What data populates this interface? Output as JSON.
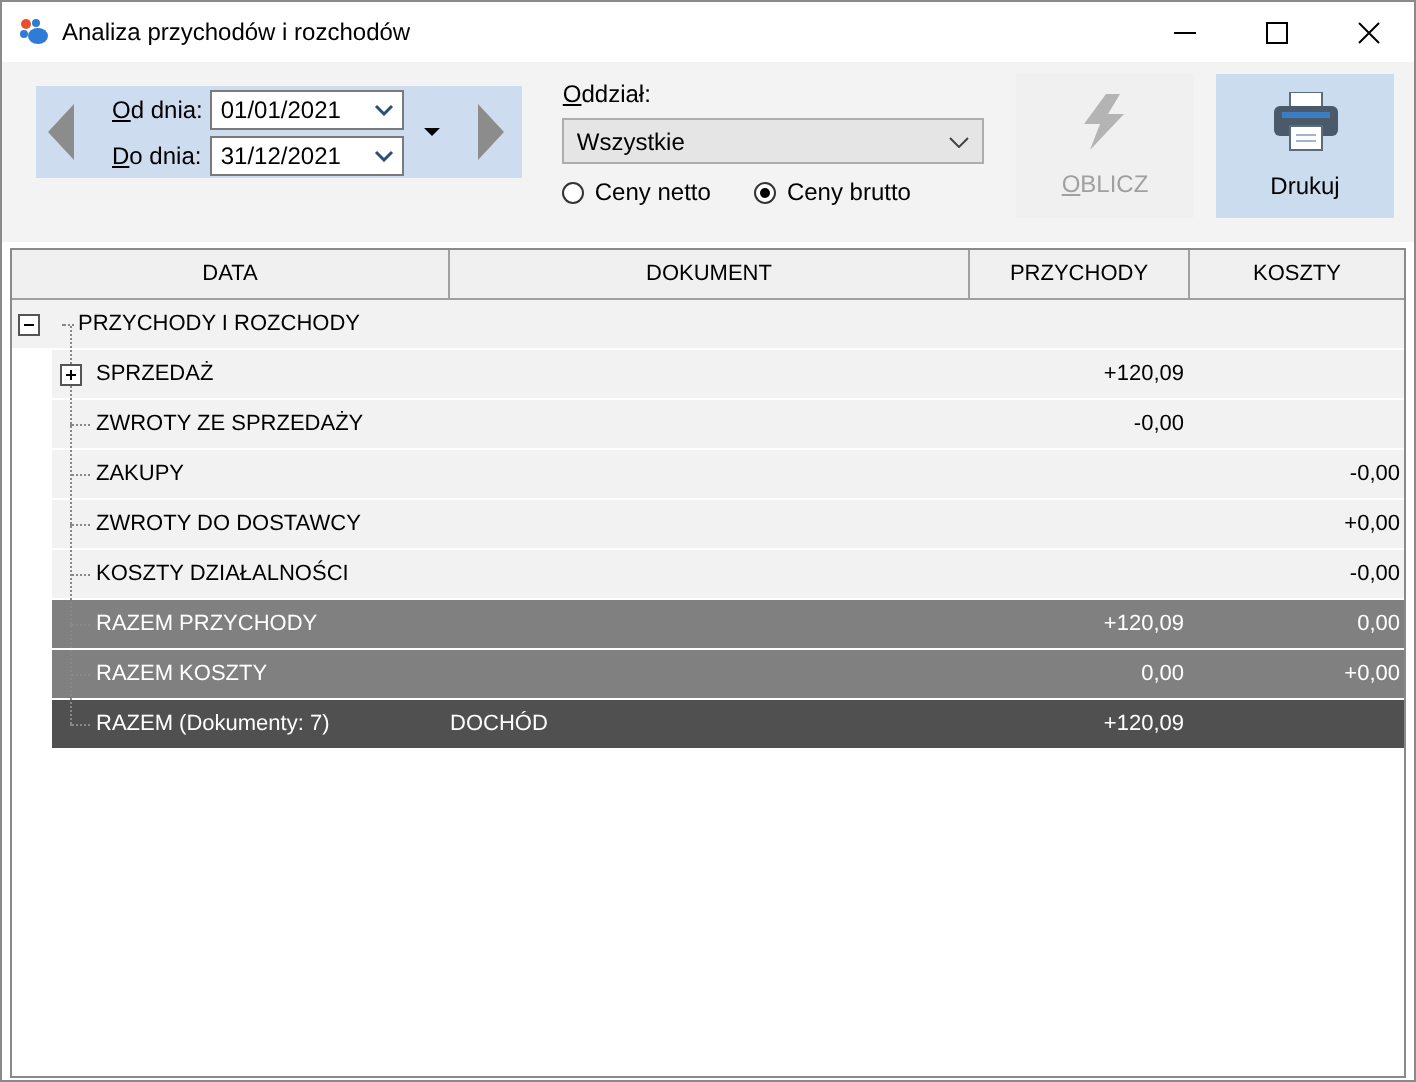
{
  "window": {
    "title": "Analiza przychodów i rozchodów"
  },
  "period": {
    "from_label": "Od dnia:",
    "from": "01/01/2021",
    "to_label": "Do dnia:",
    "to": "31/12/2021"
  },
  "branch": {
    "label": "Oddział:",
    "value": "Wszystkie"
  },
  "price_mode": [
    {
      "label": "Ceny netto",
      "selected": false
    },
    {
      "label": "Ceny brutto",
      "selected": true
    }
  ],
  "buttons": [
    {
      "kind": "calculate",
      "label": "OBLICZ",
      "disabled": true
    },
    {
      "kind": "print",
      "label": "Drukuj",
      "disabled": false
    }
  ],
  "table": {
    "columns": [
      "DATA",
      "DOKUMENT",
      "PRZYCHODY",
      "KOSZTY"
    ],
    "root": {
      "label": "PRZYCHODY I ROZCHODY",
      "expanded": true,
      "children": [
        {
          "kind": "group",
          "label": "SPRZEDAŻ",
          "expanded": false,
          "income": "+120,09"
        },
        {
          "kind": "item",
          "label": "ZWROTY ZE SPRZEDAŻY",
          "income": "-0,00"
        },
        {
          "kind": "item",
          "label": "ZAKUPY",
          "costs": "-0,00"
        },
        {
          "kind": "item",
          "label": "ZWROTY DO DOSTAWCY",
          "costs": "+0,00"
        },
        {
          "kind": "item",
          "label": "KOSZTY DZIAŁALNOŚCI",
          "costs": "-0,00"
        },
        {
          "kind": "subtotal",
          "label": "RAZEM PRZYCHODY",
          "income": "+120,09",
          "costs": "0,00"
        },
        {
          "kind": "subtotal",
          "label": "RAZEM KOSZTY",
          "income": "0,00",
          "costs": "+0,00"
        },
        {
          "kind": "total",
          "label": "RAZEM (Dokumenty: 7)",
          "document": "DOCHÓD",
          "income": "+120,09"
        }
      ]
    }
  }
}
